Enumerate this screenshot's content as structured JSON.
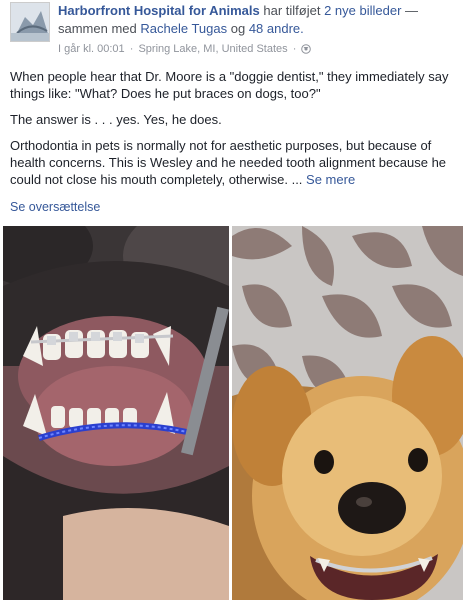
{
  "header": {
    "page_name": "Harborfront Hospital for Animals",
    "action_text": "har tilføjet",
    "photo_count_text": "2 nye billeder",
    "with_text": "— sammen med",
    "tagged_user": "Rachele Tugas",
    "and_text": "og",
    "others_text": "48 andre."
  },
  "meta": {
    "time": "I går kl. 00:01",
    "location": "Spring Lake, MI, United States",
    "separator": "·",
    "audience_icon": "globe-icon"
  },
  "post": {
    "paragraph_1": "When people hear that Dr. Moore is a \"doggie dentist,\" they immediately say things like: \"What? Does he put braces on dogs, too?\"",
    "paragraph_2": "The answer is . . . yes. Yes, he does.",
    "paragraph_3": "Orthodontia in pets is normally not for aesthetic purposes, but because of health concerns. This is Wesley and he needed tooth alignment because he could not close his mouth completely, otherwise.",
    "ellipsis": "...",
    "see_more": "Se mere"
  },
  "translate_link": "Se oversættelse",
  "colors": {
    "link": "#365899",
    "text": "#1d2129",
    "meta": "#90949c"
  }
}
